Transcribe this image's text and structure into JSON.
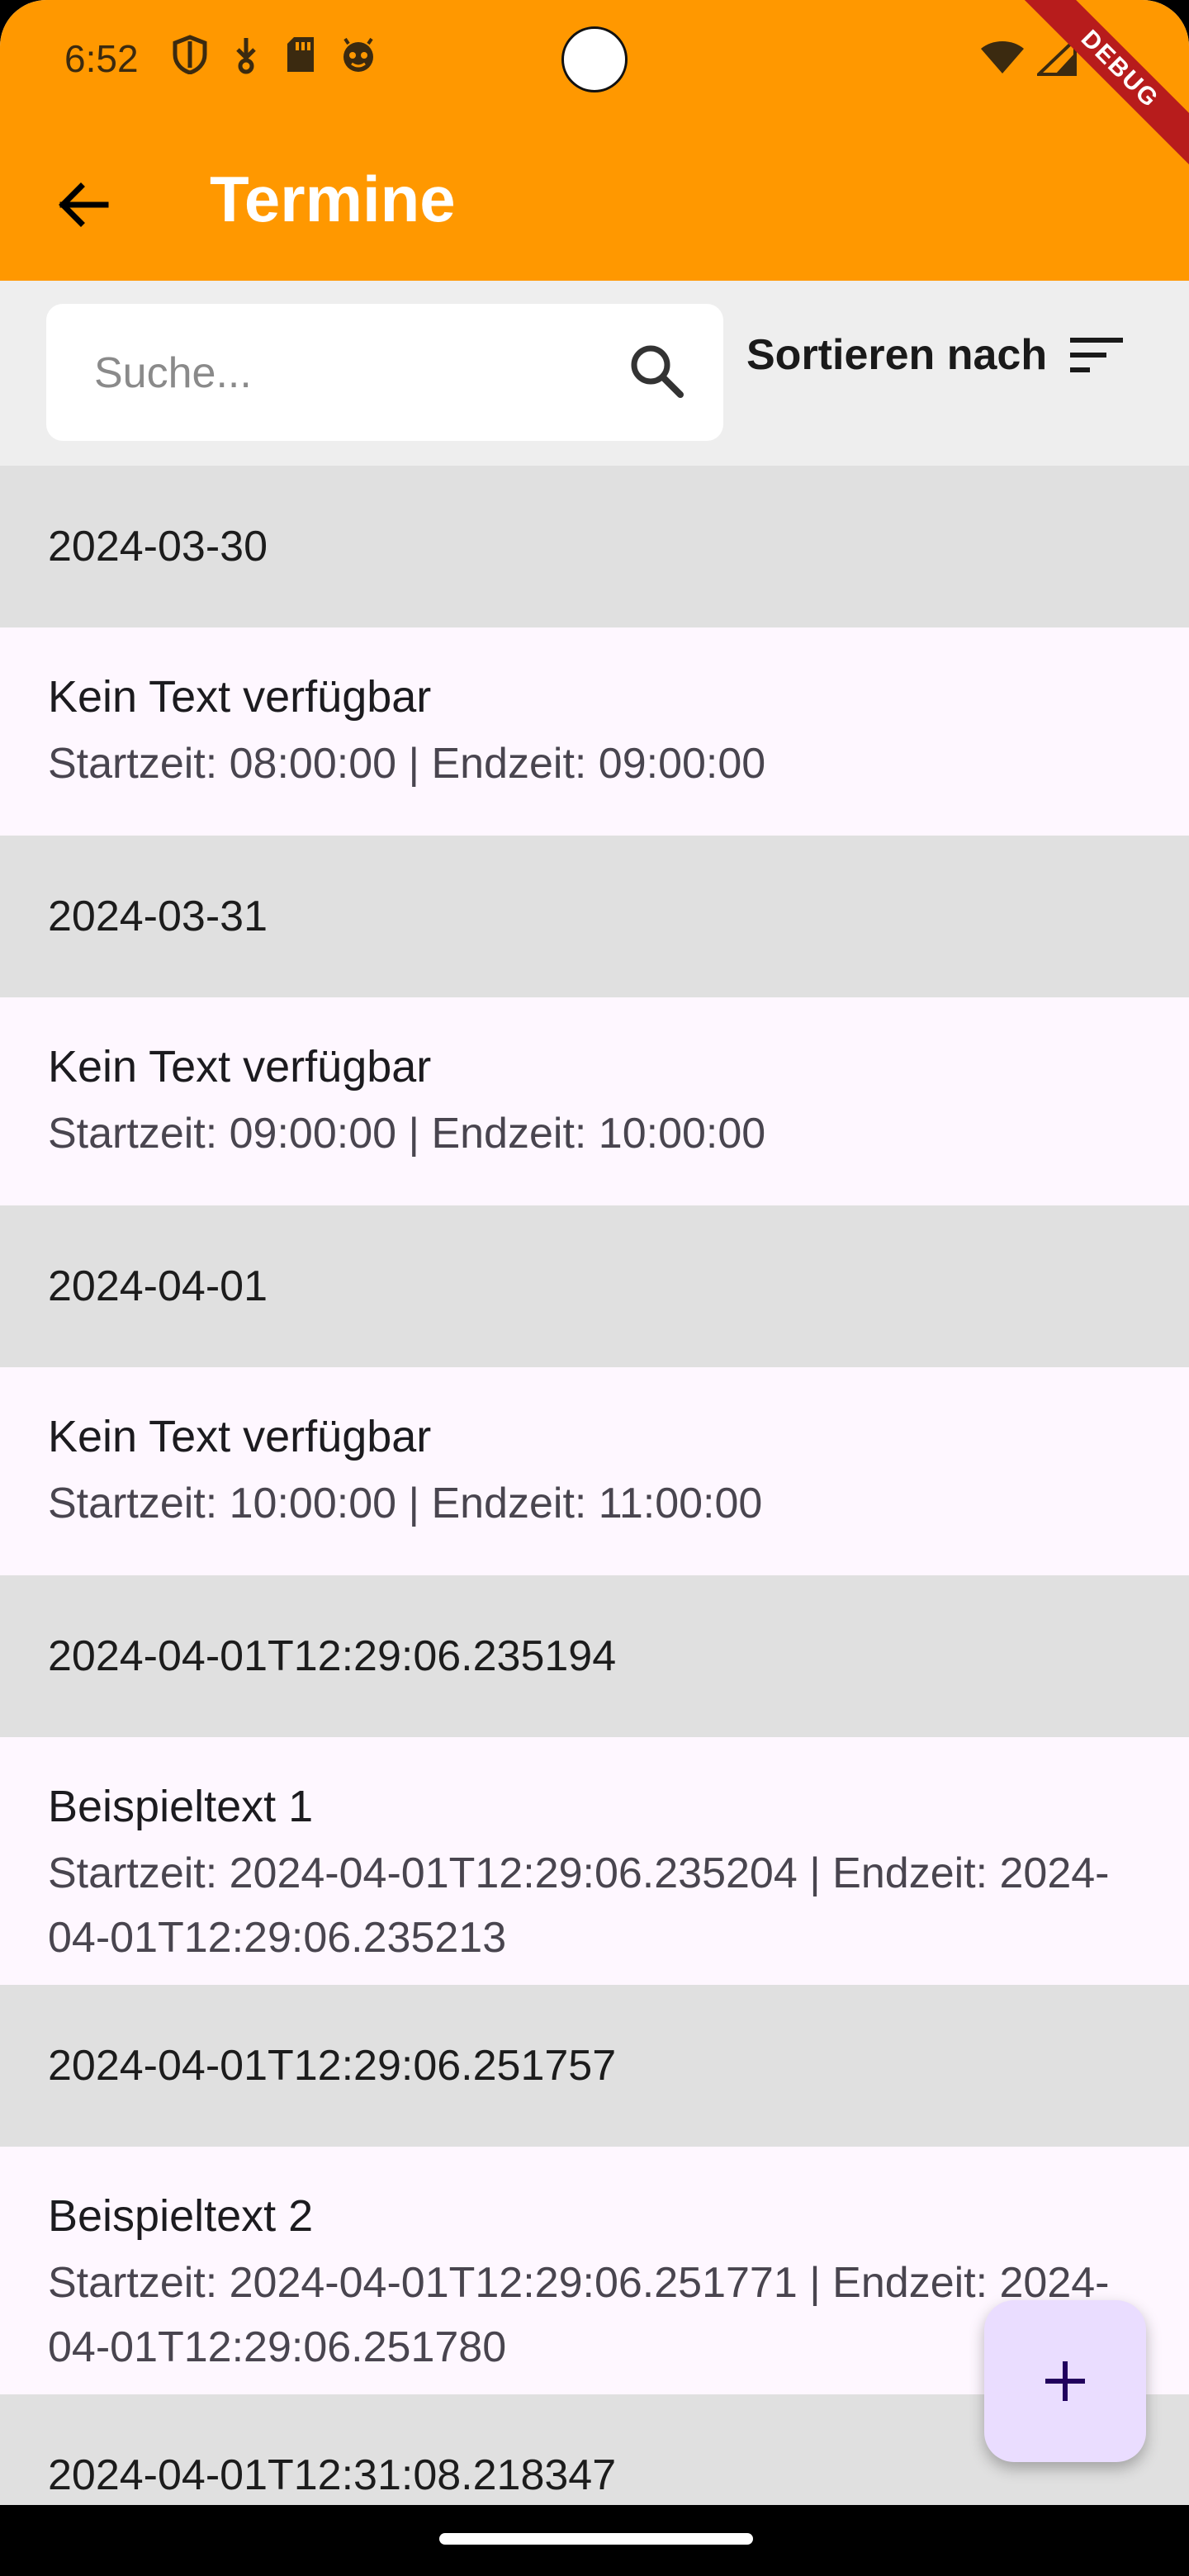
{
  "status_bar": {
    "time": "6:52",
    "debug_label": "DEBUG"
  },
  "appbar": {
    "title": "Termine",
    "color": "#ff9800"
  },
  "search": {
    "placeholder": "Suche...",
    "value": ""
  },
  "sort": {
    "label": "Sortieren nach"
  },
  "groups": [
    {
      "date": "2024-03-30",
      "item": {
        "title": "Kein Text verfügbar",
        "sub": "Startzeit: 08:00:00 | Endzeit: 09:00:00"
      }
    },
    {
      "date": "2024-03-31",
      "item": {
        "title": "Kein Text verfügbar",
        "sub": "Startzeit: 09:00:00 | Endzeit: 10:00:00"
      }
    },
    {
      "date": "2024-04-01",
      "item": {
        "title": "Kein Text verfügbar",
        "sub": "Startzeit: 10:00:00 | Endzeit: 11:00:00"
      }
    },
    {
      "date": "2024-04-01T12:29:06.235194",
      "item": {
        "title": "Beispieltext 1",
        "sub": "Startzeit: 2024-04-01T12:29:06.235204 | Endzeit: 2024-04-01T12:29:06.235213"
      }
    },
    {
      "date": "2024-04-01T12:29:06.251757",
      "item": {
        "title": "Beispieltext 2",
        "sub": "Startzeit: 2024-04-01T12:29:06.251771 | Endzeit: 2024-04-01T12:29:06.251780"
      }
    },
    {
      "date": "2024-04-01T12:31:08.218347"
    }
  ],
  "fab": {
    "icon": "plus-icon"
  }
}
